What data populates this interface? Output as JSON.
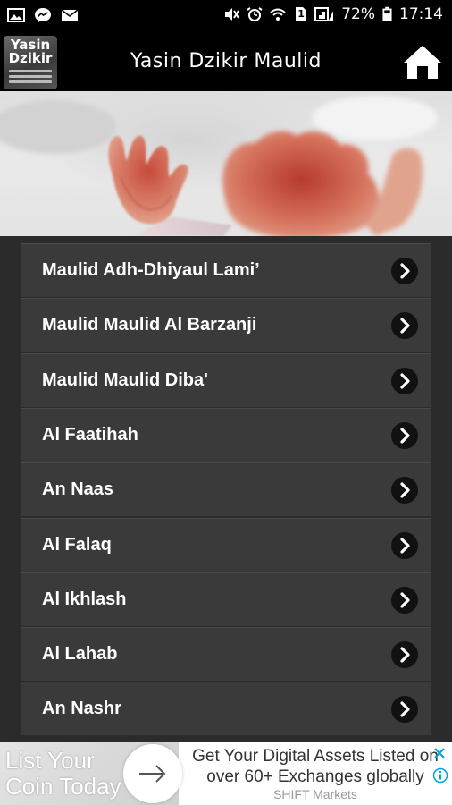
{
  "status_bar": {
    "left_icons": [
      "gallery-icon",
      "messenger-icon",
      "mail-icon"
    ],
    "right_icons": [
      "mute-icon",
      "alarm-icon",
      "wifi-icon",
      "sim-icon",
      "signal-icon",
      "battery-icon"
    ],
    "sim_label": "1",
    "battery": "72%",
    "time": "17:14"
  },
  "app_bar": {
    "logo_line1": "Yasin",
    "logo_line2": "Dzikir",
    "title": "Yasin Dzikir Maulid",
    "home_icon": "home-icon"
  },
  "banner": {
    "image": "praying-hands-photo"
  },
  "menu": {
    "items": [
      {
        "label": "Maulid Adh-Dhiyaul Lami’"
      },
      {
        "label": "Maulid Maulid Al Barzanji"
      },
      {
        "label": "Maulid Maulid Diba'"
      },
      {
        "label": "Al Faatihah"
      },
      {
        "label": "An Naas"
      },
      {
        "label": "Al Falaq"
      },
      {
        "label": "Al Ikhlash"
      },
      {
        "label": "Al Lahab"
      },
      {
        "label": "An Nashr"
      }
    ],
    "arrow_icon": "chevron-right-icon"
  },
  "ad": {
    "left_text": "List Your Coin Today",
    "headline": "Get Your Digital Assets Listed on over 60+ Exchanges globally",
    "source": "SHIFT Markets",
    "info_icon": "info-icon",
    "close_icon": "close-icon"
  },
  "colors": {
    "app_bar_bg": "#000000",
    "list_row_bg": "#3a3a3a",
    "page_bg": "#2b2b2b",
    "ad_bg": "#ffffff",
    "info_accent": "#00a3e0"
  }
}
